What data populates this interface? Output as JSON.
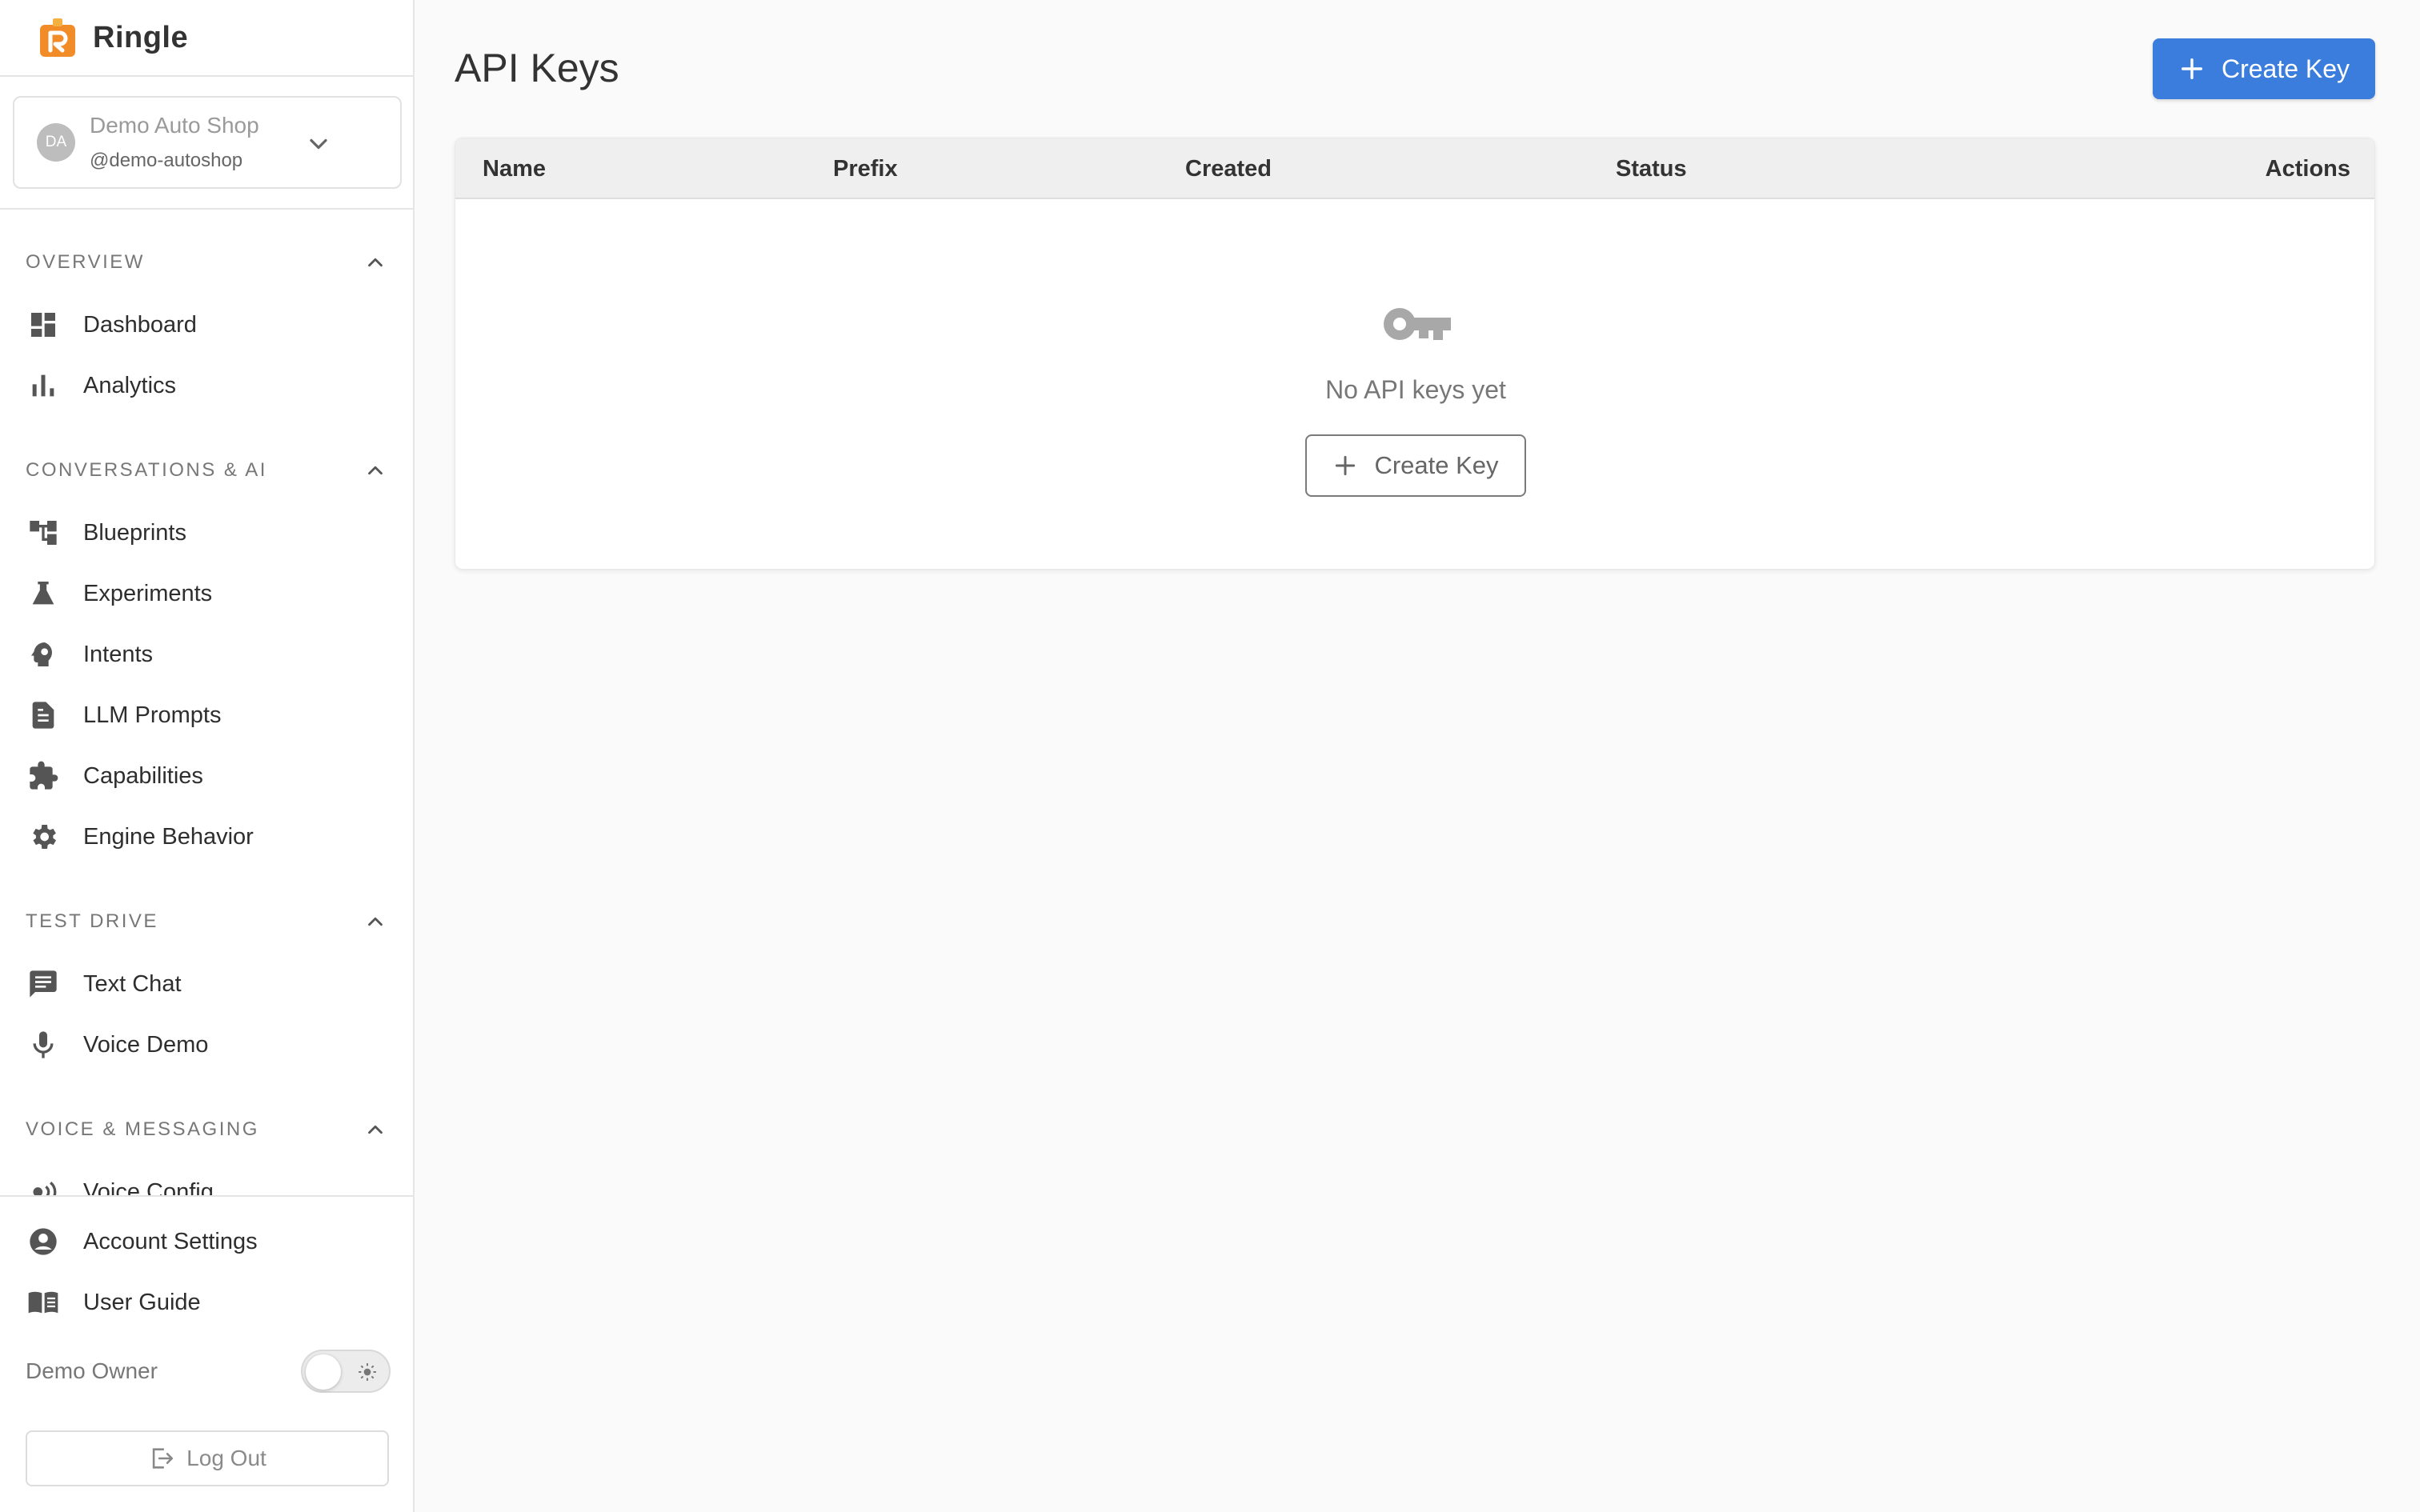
{
  "brand": {
    "name": "Ringle",
    "logo_icon": "ringle-logo-icon",
    "accent": "#f28c28"
  },
  "workspace": {
    "avatar_initials": "DA",
    "name": "Demo Auto Shop",
    "handle": "@demo-autoshop"
  },
  "sidebar": {
    "sections": [
      {
        "title": "OVERVIEW",
        "items": [
          {
            "label": "Dashboard",
            "icon": "dashboard-icon"
          },
          {
            "label": "Analytics",
            "icon": "bar-chart-icon"
          }
        ]
      },
      {
        "title": "CONVERSATIONS & AI",
        "items": [
          {
            "label": "Blueprints",
            "icon": "tree-icon"
          },
          {
            "label": "Experiments",
            "icon": "flask-icon"
          },
          {
            "label": "Intents",
            "icon": "brain-head-icon"
          },
          {
            "label": "LLM Prompts",
            "icon": "document-icon"
          },
          {
            "label": "Capabilities",
            "icon": "puzzle-icon"
          },
          {
            "label": "Engine Behavior",
            "icon": "gear-icon"
          }
        ]
      },
      {
        "title": "TEST DRIVE",
        "items": [
          {
            "label": "Text Chat",
            "icon": "chat-icon"
          },
          {
            "label": "Voice Demo",
            "icon": "microphone-icon"
          }
        ]
      },
      {
        "title": "VOICE & MESSAGING",
        "items": [
          {
            "label": "Voice Config",
            "icon": "voice-wave-icon"
          }
        ]
      }
    ],
    "bottom": [
      {
        "label": "Account Settings",
        "icon": "account-circle-icon"
      },
      {
        "label": "User Guide",
        "icon": "book-icon"
      }
    ],
    "user_name": "Demo Owner",
    "theme_toggle_icon": "sun-icon",
    "logout_label": "Log Out"
  },
  "main": {
    "title": "API Keys",
    "create_button_label": "Create Key",
    "primary_color": "#3b7ddd",
    "table": {
      "columns": [
        "Name",
        "Prefix",
        "Created",
        "Status",
        "Actions"
      ]
    },
    "empty_state": {
      "icon": "key-icon",
      "message": "No API keys yet",
      "button_label": "Create Key"
    }
  }
}
